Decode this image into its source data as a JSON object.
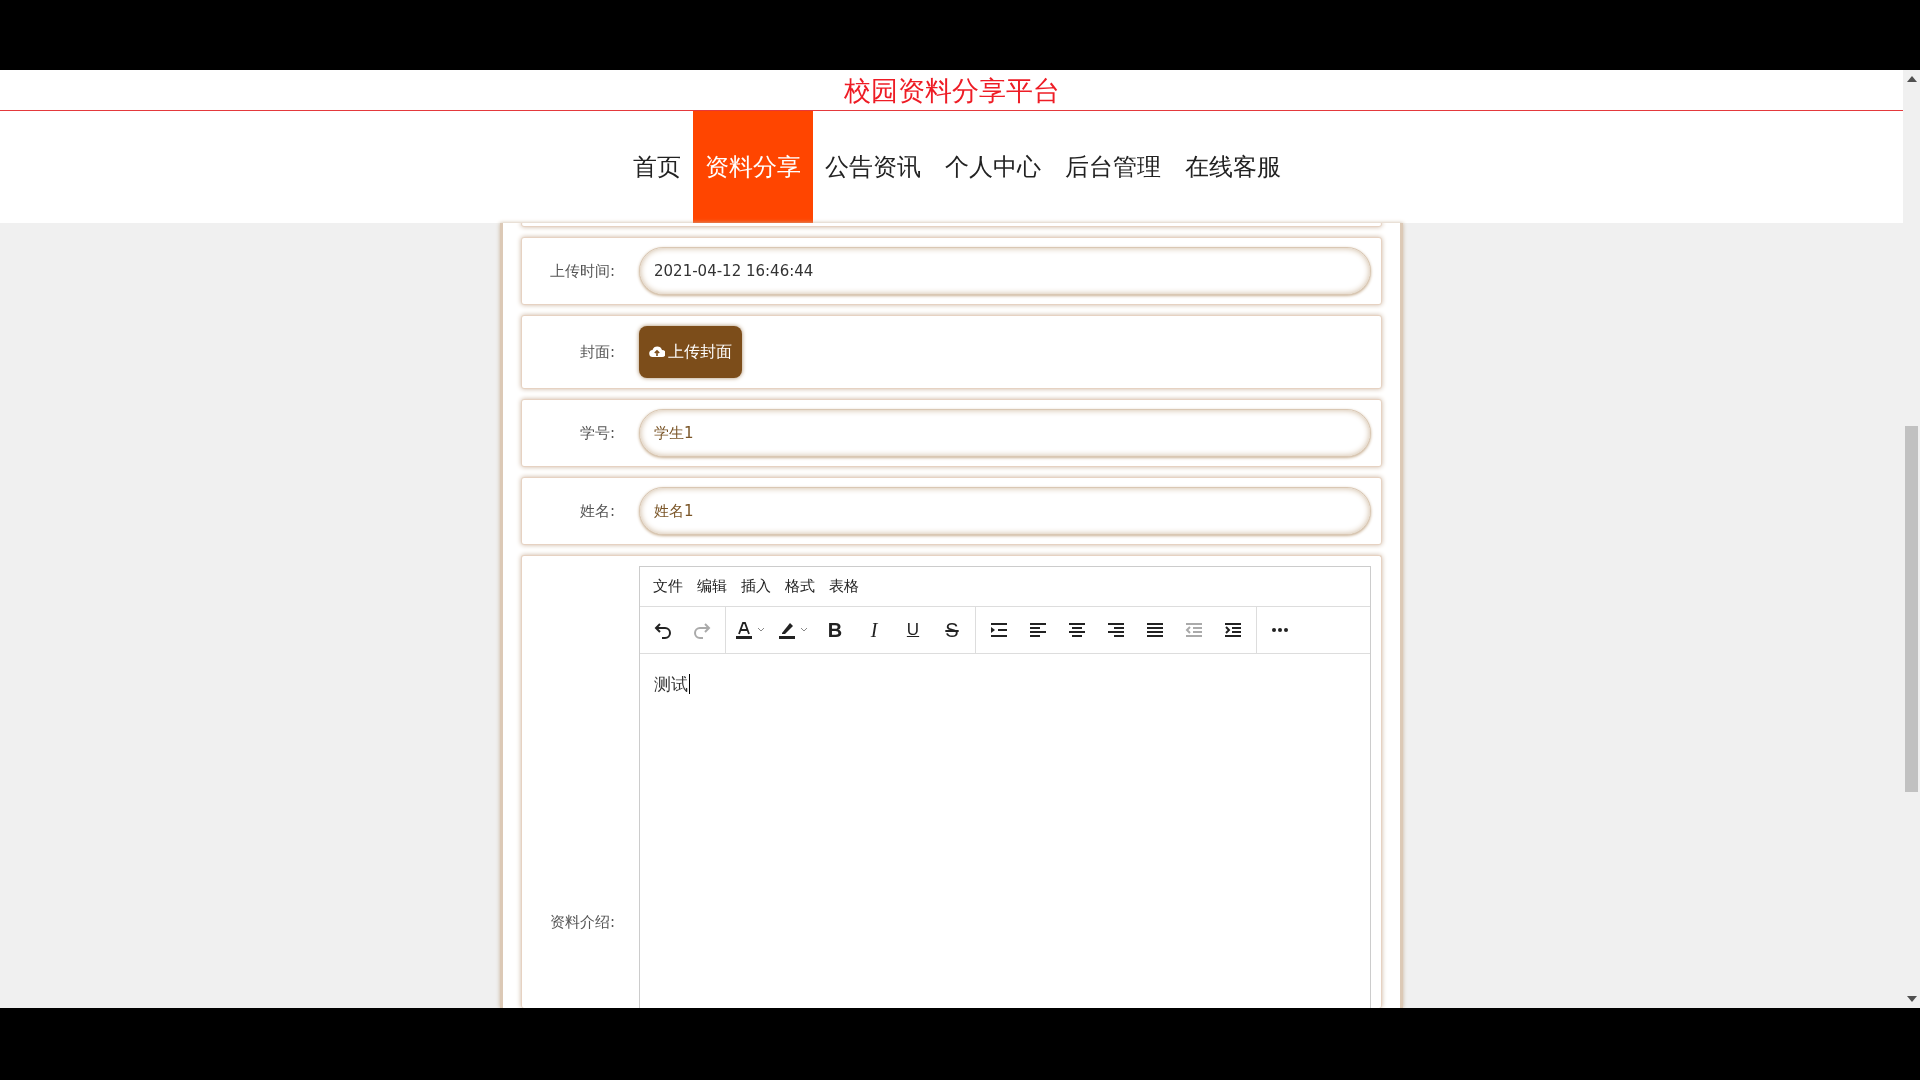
{
  "site_title": "校园资料分享平台",
  "nav": [
    {
      "label": "首页",
      "selected": false
    },
    {
      "label": "资料分享",
      "selected": true
    },
    {
      "label": "公告资讯",
      "selected": false
    },
    {
      "label": "个人中心",
      "selected": false
    },
    {
      "label": "后台管理",
      "selected": false
    },
    {
      "label": "在线客服",
      "selected": false
    }
  ],
  "form_rows": [
    {
      "kind": "input",
      "label": "上传时间:",
      "value": "2021-04-12 16:46:44",
      "readonly": true
    },
    {
      "kind": "upload",
      "label": "封面:",
      "button": "上传封面"
    },
    {
      "kind": "input",
      "label": "学号:",
      "value": "学生1",
      "readonly": false
    },
    {
      "kind": "input",
      "label": "姓名:",
      "value": "姓名1",
      "readonly": false
    },
    {
      "kind": "editor",
      "label": "资料介绍:",
      "content": "测试"
    }
  ],
  "editor": {
    "menus": [
      "文件",
      "编辑",
      "插入",
      "格式",
      "表格"
    ],
    "toolbar_groups": [
      [
        {
          "kind": "undo",
          "disabled": false
        },
        {
          "kind": "redo",
          "disabled": true
        }
      ],
      [
        {
          "kind": "text-color",
          "disabled": false
        },
        {
          "kind": "highlight",
          "disabled": false
        },
        {
          "kind": "bold",
          "label": "B",
          "disabled": false
        },
        {
          "kind": "italic",
          "label": "I",
          "disabled": false
        },
        {
          "kind": "underline",
          "label": "U",
          "disabled": false
        },
        {
          "kind": "strikethrough",
          "label": "S",
          "disabled": false
        }
      ],
      [
        {
          "kind": "line-height",
          "disabled": false
        },
        {
          "kind": "align-left",
          "disabled": false
        },
        {
          "kind": "align-center",
          "disabled": false
        },
        {
          "kind": "align-right",
          "disabled": false
        },
        {
          "kind": "justify",
          "disabled": false
        },
        {
          "kind": "outdent",
          "disabled": true
        },
        {
          "kind": "indent",
          "disabled": false
        }
      ],
      [
        {
          "kind": "more",
          "disabled": false
        }
      ]
    ]
  }
}
